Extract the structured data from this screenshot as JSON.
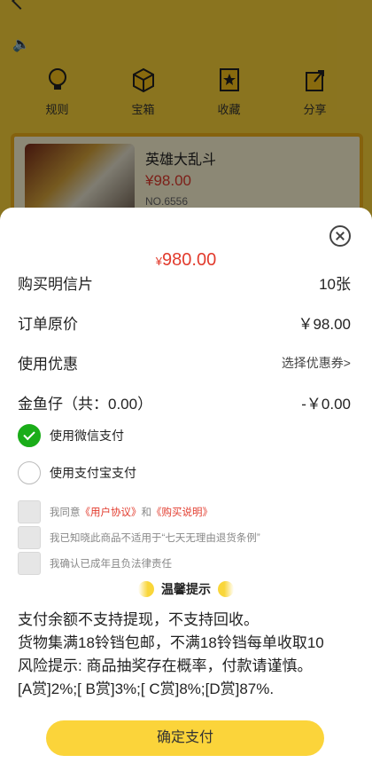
{
  "background": {
    "icons": [
      {
        "label": "规则",
        "icon": "lightbulb-icon"
      },
      {
        "label": "宝箱",
        "icon": "box-icon"
      },
      {
        "label": "收藏",
        "icon": "bookmark-star-icon"
      },
      {
        "label": "分享",
        "icon": "share-icon"
      }
    ],
    "product": {
      "name": "英雄大乱斗",
      "price": "¥98.00",
      "no": "NO.6556"
    }
  },
  "sheet": {
    "total_currency": "¥",
    "total_amount": "980.00",
    "rows": {
      "card_label": "购买明信片",
      "card_value": "10张",
      "original_label": "订单原价",
      "original_value": "￥98.00",
      "coupon_label": "使用优惠",
      "coupon_value": "选择优惠券>",
      "goldfish_label": "金鱼仔（共：0.00）",
      "goldfish_value": "-￥0.00"
    },
    "payment": {
      "wechat": "使用微信支付",
      "alipay": "使用支付宝支付"
    },
    "agreements": {
      "a1_prefix": "我同意",
      "a1_link1": "《用户协议》",
      "a1_and": "和",
      "a1_link2": "《购买说明》",
      "a2": "我已知晓此商品不适用于“七天无理由退货条例”",
      "a3": "我确认已成年且负法律责任"
    },
    "tips_title": "温馨提示",
    "notes": [
      "支付余额不支持提现，不支持回收。",
      "货物集满18铃铛包邮，不满18铃铛每单收取10",
      "风险提示: 商品抽奖存在概率，付款请谨慎。",
      "[A赏]2%;[ B赏]3%;[ C赏]8%;[D赏]87%."
    ],
    "confirm_label": "确定支付"
  },
  "colors": {
    "accent": "#fbd43a",
    "price": "#e23b2d",
    "wechat_green": "#1aad19"
  }
}
